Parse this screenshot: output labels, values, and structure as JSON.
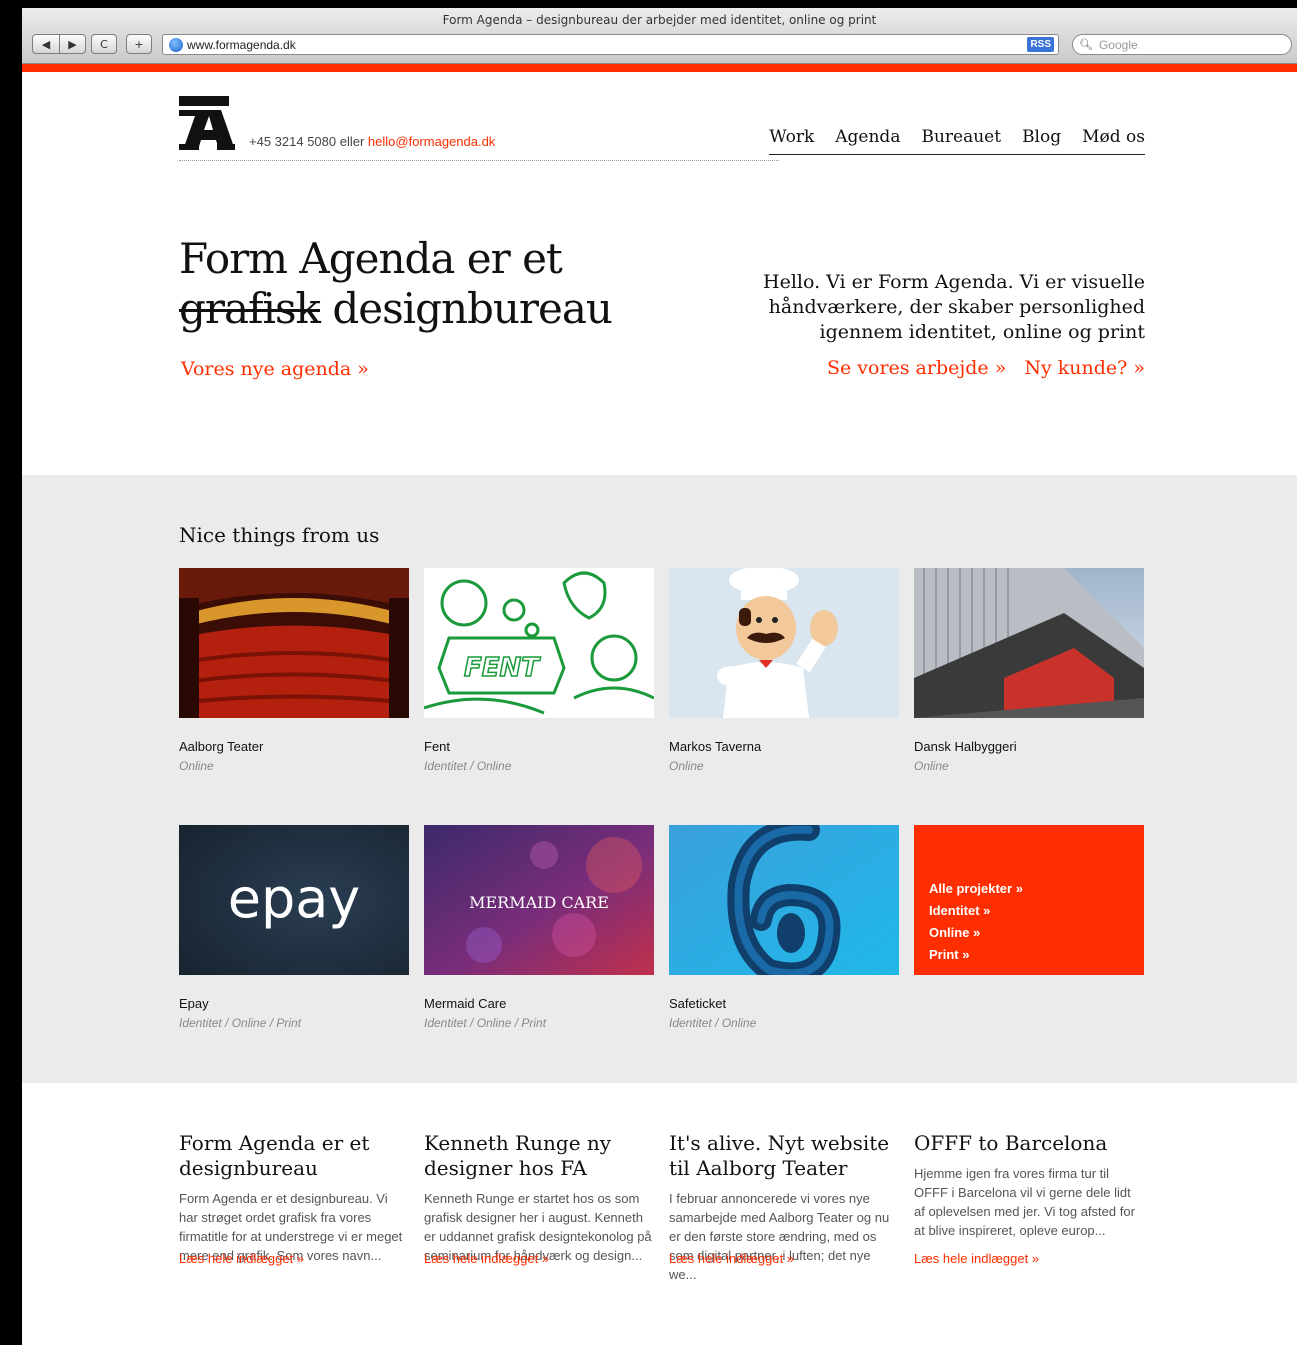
{
  "browser": {
    "window_title": "Form Agenda – designbureau der arbejder med identitet, online og print",
    "back_label": "◀",
    "forward_label": "▶",
    "reload_label": "C",
    "add_label": "+",
    "url": "www.formagenda.dk",
    "rss_label": "RSS",
    "search_placeholder": "Google"
  },
  "header": {
    "phone": "+45 3214 5080",
    "or_text": " eller ",
    "email": "hello@formagenda.dk",
    "nav": [
      "Work",
      "Agenda",
      "Bureauet",
      "Blog",
      "Mød os"
    ]
  },
  "intro": {
    "headline_line1": "Form Agenda er et",
    "headline_struck": "grafisk",
    "headline_line2_rest": " designbureau",
    "headline_link": "Vores nye agenda »",
    "tagline": "Hello. Vi er Form Agenda. Vi er visuelle håndværkere, der skaber personlighed igennem identitet, online og print",
    "link_work": "Se vores arbejde »",
    "link_new_client": "Ny kunde? »"
  },
  "work": {
    "title": "Nice things from us",
    "thumb_texts": {
      "fent": "FENT",
      "epay": "epay",
      "mermaid": "MERMAID CARE"
    },
    "projects": [
      {
        "name": "Aalborg Teater",
        "tags": "Online"
      },
      {
        "name": "Fent",
        "tags": "Identitet / Online"
      },
      {
        "name": "Markos Taverna",
        "tags": "Online"
      },
      {
        "name": "Dansk Halbyggeri",
        "tags": "Online"
      },
      {
        "name": "Epay",
        "tags": "Identitet / Online / Print"
      },
      {
        "name": "Mermaid Care",
        "tags": "Identitet / Online / Print"
      },
      {
        "name": "Safeticket",
        "tags": "Identitet / Online"
      }
    ],
    "all_links": [
      "Alle projekter »",
      "Identitet »",
      "Online »",
      "Print »"
    ]
  },
  "blog": {
    "posts": [
      {
        "title": "Form Agenda er et designbureau",
        "body": "Form Agenda er et designbureau. Vi har strøget ordet grafisk fra vores firmatitle for at understrege vi er meget mere end grafik. Som vores navn...",
        "more": "Læs hele indlægget »"
      },
      {
        "title": "Kenneth Runge ny designer hos FA",
        "body": "Kenneth Runge er startet hos os som grafisk designer her i august. Kenneth er uddannet grafisk designtekonolog på seminarium for håndværk og design...",
        "more": "Læs hele indlægget »"
      },
      {
        "title": "It's alive. Nyt website til Aalborg Teater",
        "body": "I februar annoncerede vi vores nye samarbejde med Aalborg Teater og nu er den første store ændring, med os som digital partner, i luften; det nye we...",
        "more": "Læs hele indlægget »"
      },
      {
        "title": "OFFF to Barcelona",
        "body": "Hjemme igen fra vores firma tur til OFFF i Barcelona vil vi gerne dele lidt af oplevelsen med jer. Vi tog afsted for at blive inspireret, opleve europ...",
        "more": "Læs hele indlægget »"
      }
    ]
  },
  "colors": {
    "accent": "#ff2e00",
    "grey_band": "#ebebeb",
    "text": "#111111"
  }
}
